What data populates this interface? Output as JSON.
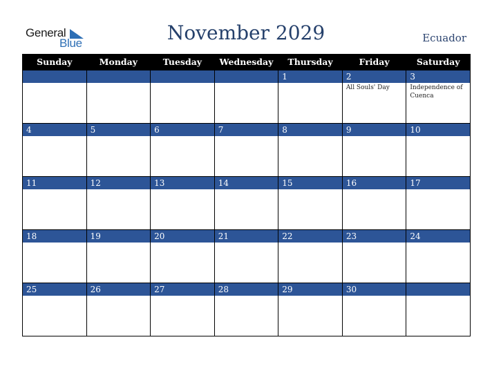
{
  "logo": {
    "word1": "General",
    "word2": "Blue"
  },
  "header": {
    "title": "November 2029",
    "country": "Ecuador"
  },
  "colors": {
    "band": "#2d5597",
    "header_bg": "#000000",
    "title": "#25406b"
  },
  "weekdays": [
    "Sunday",
    "Monday",
    "Tuesday",
    "Wednesday",
    "Thursday",
    "Friday",
    "Saturday"
  ],
  "weeks": [
    [
      {
        "day": ""
      },
      {
        "day": ""
      },
      {
        "day": ""
      },
      {
        "day": ""
      },
      {
        "day": "1"
      },
      {
        "day": "2",
        "holiday": "All Souls' Day"
      },
      {
        "day": "3",
        "holiday": "Independence of Cuenca"
      }
    ],
    [
      {
        "day": "4"
      },
      {
        "day": "5"
      },
      {
        "day": "6"
      },
      {
        "day": "7"
      },
      {
        "day": "8"
      },
      {
        "day": "9"
      },
      {
        "day": "10"
      }
    ],
    [
      {
        "day": "11"
      },
      {
        "day": "12"
      },
      {
        "day": "13"
      },
      {
        "day": "14"
      },
      {
        "day": "15"
      },
      {
        "day": "16"
      },
      {
        "day": "17"
      }
    ],
    [
      {
        "day": "18"
      },
      {
        "day": "19"
      },
      {
        "day": "20"
      },
      {
        "day": "21"
      },
      {
        "day": "22"
      },
      {
        "day": "23"
      },
      {
        "day": "24"
      }
    ],
    [
      {
        "day": "25"
      },
      {
        "day": "26"
      },
      {
        "day": "27"
      },
      {
        "day": "28"
      },
      {
        "day": "29"
      },
      {
        "day": "30"
      },
      {
        "day": ""
      }
    ]
  ]
}
